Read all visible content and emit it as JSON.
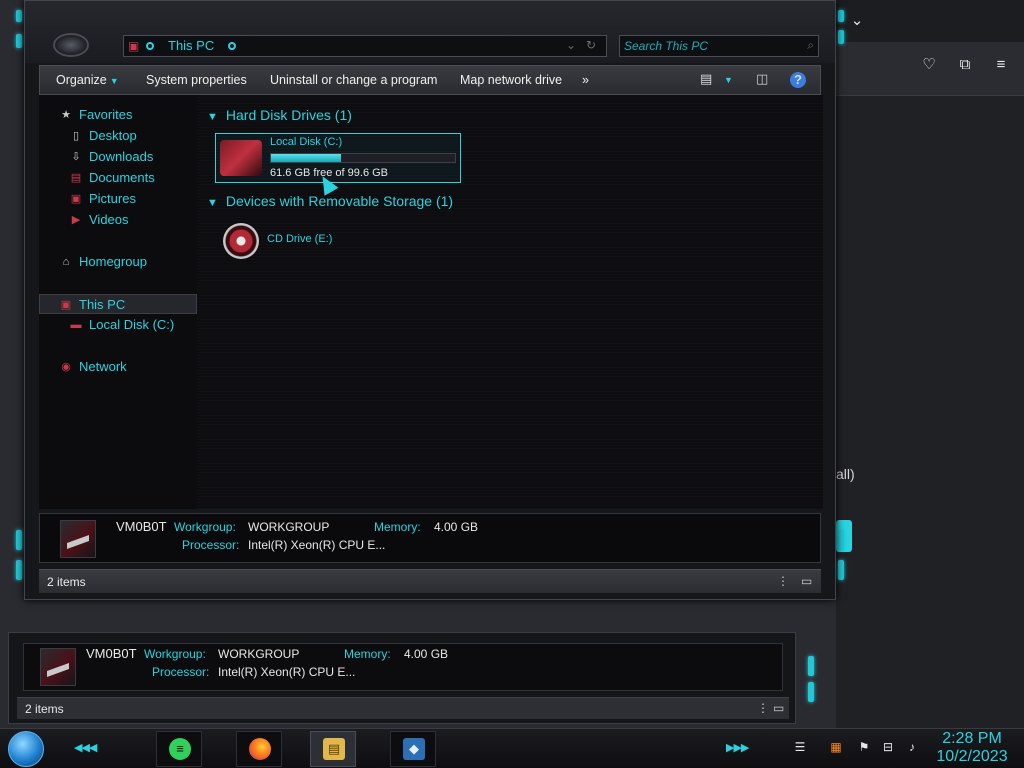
{
  "window": {
    "breadcrumb": "This PC",
    "search_placeholder": "Search This PC"
  },
  "commandbar": {
    "organize": "Organize",
    "system_properties": "System properties",
    "uninstall": "Uninstall or change a program",
    "map_drive": "Map network drive",
    "more": "»",
    "help": "?"
  },
  "nav": {
    "favorites": "Favorites",
    "desktop": "Desktop",
    "downloads": "Downloads",
    "documents": "Documents",
    "pictures": "Pictures",
    "videos": "Videos",
    "homegroup": "Homegroup",
    "this_pc": "This PC",
    "local_disk": "Local Disk (C:)",
    "network": "Network"
  },
  "content": {
    "hdd_header": "Hard Disk Drives (1)",
    "drive_name": "Local Disk (C:)",
    "drive_free": "61.6 GB free of 99.6 GB",
    "drive_used_fraction": 0.38,
    "removable_header": "Devices with Removable Storage (1)",
    "cd_name": "CD Drive (E:)"
  },
  "details": {
    "computer_name": "VM0B0T",
    "workgroup_label": "Workgroup:",
    "workgroup_value": "WORKGROUP",
    "memory_label": "Memory:",
    "memory_value": "4.00 GB",
    "processor_label": "Processor:",
    "processor_value": "Intel(R) Xeon(R) CPU E..."
  },
  "status": {
    "item_count": "2 items"
  },
  "background_page": {
    "text": "all)"
  },
  "taskbar": {
    "time": "2:28 PM",
    "date": "10/2/2023"
  },
  "colors": {
    "accent": "#2ad3e0",
    "window_bg": "#16171b",
    "content_bg": "#0d0d10"
  }
}
